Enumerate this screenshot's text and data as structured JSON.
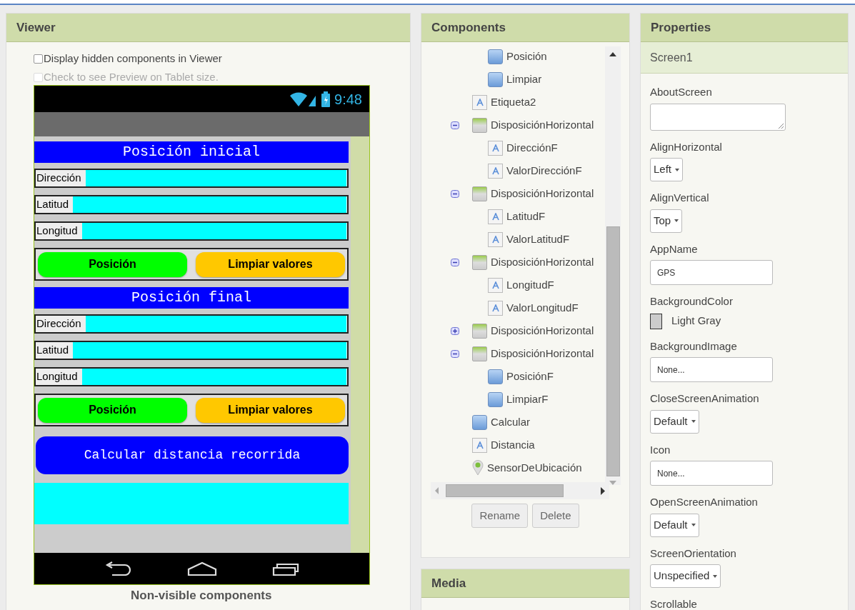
{
  "viewer": {
    "title": "Viewer",
    "options": [
      {
        "label": "Display hidden components in Viewer",
        "checked": false,
        "disabled": false
      },
      {
        "label": "Check to see Preview on Tablet size.",
        "checked": false,
        "disabled": true
      }
    ],
    "phone": {
      "time": "9:48",
      "sections": [
        {
          "title": "Posición inicial",
          "fields": [
            {
              "label": "Dirección"
            },
            {
              "label": "Latitud"
            },
            {
              "label": "Longitud"
            }
          ],
          "buttons": [
            {
              "label": "Posición",
              "color": "#00ff00"
            },
            {
              "label": "Limpiar valores",
              "color": "#ffc800"
            }
          ]
        },
        {
          "title": "Posición final",
          "fields": [
            {
              "label": "Dirección"
            },
            {
              "label": "Latitud"
            },
            {
              "label": "Longitud"
            }
          ],
          "buttons": [
            {
              "label": "Posición",
              "color": "#00ff00"
            },
            {
              "label": "Limpiar valores",
              "color": "#ffc800"
            }
          ]
        }
      ],
      "calculate_button": "Calcular distancia recorrida"
    },
    "non_visible_title": "Non-visible components"
  },
  "components": {
    "title": "Components",
    "tree": [
      {
        "kind": "layout",
        "children": [
          {
            "kind": "button",
            "label": "Posición"
          },
          {
            "kind": "button",
            "label": "Limpiar"
          }
        ]
      },
      {
        "kind": "label",
        "label": "Etiqueta2"
      },
      {
        "kind": "layout",
        "label": "DisposiciónHorizontal",
        "expanded": true,
        "children": [
          {
            "kind": "label",
            "label": "DirecciónF"
          },
          {
            "kind": "label",
            "label": "ValorDirecciónF"
          }
        ]
      },
      {
        "kind": "layout",
        "label": "DisposiciónHorizontal",
        "expanded": true,
        "children": [
          {
            "kind": "label",
            "label": "LatitudF"
          },
          {
            "kind": "label",
            "label": "ValorLatitudF"
          }
        ]
      },
      {
        "kind": "layout",
        "label": "DisposiciónHorizontal",
        "expanded": true,
        "children": [
          {
            "kind": "label",
            "label": "LongitudF"
          },
          {
            "kind": "label",
            "label": "ValorLongitudF"
          }
        ]
      },
      {
        "kind": "layout",
        "label": "DisposiciónHorizontal",
        "expanded": false
      },
      {
        "kind": "layout",
        "label": "DisposiciónHorizontal",
        "expanded": true,
        "children": [
          {
            "kind": "button",
            "label": "PosiciónF"
          },
          {
            "kind": "button",
            "label": "LimpiarF"
          }
        ]
      },
      {
        "kind": "button",
        "label": "Calcular"
      },
      {
        "kind": "label",
        "label": "Distancia"
      },
      {
        "kind": "sensor",
        "label": "SensorDeUbicación"
      }
    ],
    "buttons": [
      "Rename",
      "Delete"
    ]
  },
  "media": {
    "title": "Media"
  },
  "properties": {
    "title": "Properties",
    "component": "Screen1",
    "items": [
      {
        "kind": "textarea",
        "name": "AboutScreen"
      },
      {
        "kind": "select",
        "name": "AlignHorizontal",
        "value": "Left"
      },
      {
        "kind": "select",
        "name": "AlignVertical",
        "value": "Top"
      },
      {
        "kind": "text",
        "name": "AppName",
        "value": "GPS"
      },
      {
        "kind": "color",
        "name": "BackgroundColor",
        "value": "Light Gray",
        "color": "#cccccc"
      },
      {
        "kind": "text",
        "name": "BackgroundImage",
        "value": "None..."
      },
      {
        "kind": "select",
        "name": "CloseScreenAnimation",
        "value": "Default"
      },
      {
        "kind": "text",
        "name": "Icon",
        "value": "None..."
      },
      {
        "kind": "select",
        "name": "OpenScreenAnimation",
        "value": "Default"
      },
      {
        "kind": "select",
        "name": "ScreenOrientation",
        "value": "Unspecified"
      },
      {
        "kind": "heading",
        "name": "Scrollable"
      }
    ]
  }
}
